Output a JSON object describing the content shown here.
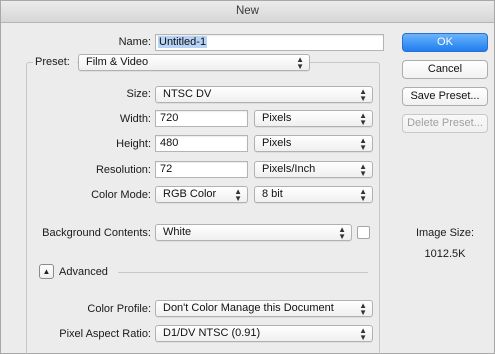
{
  "window": {
    "title": "New"
  },
  "form": {
    "name": {
      "label": "Name:",
      "value": "Untitled-1"
    },
    "preset": {
      "label": "Preset:",
      "value": "Film & Video"
    },
    "size": {
      "label": "Size:",
      "value": "NTSC DV"
    },
    "width": {
      "label": "Width:",
      "value": "720",
      "unit": "Pixels"
    },
    "height": {
      "label": "Height:",
      "value": "480",
      "unit": "Pixels"
    },
    "resolution": {
      "label": "Resolution:",
      "value": "72",
      "unit": "Pixels/Inch"
    },
    "color_mode": {
      "label": "Color Mode:",
      "value": "RGB Color",
      "depth": "8 bit"
    },
    "background": {
      "label": "Background Contents:",
      "value": "White",
      "swatch": "#ffffff"
    },
    "advanced": {
      "label": "Advanced",
      "expanded": true
    },
    "color_profile": {
      "label": "Color Profile:",
      "value": "Don't Color Manage this Document"
    },
    "pixel_aspect": {
      "label": "Pixel Aspect Ratio:",
      "value": "D1/DV NTSC (0.91)"
    }
  },
  "buttons": {
    "ok": "OK",
    "cancel": "Cancel",
    "save_preset": "Save Preset...",
    "delete_preset": "Delete Preset..."
  },
  "image_size": {
    "label": "Image Size:",
    "value": "1012.5K"
  },
  "icons": {
    "popup_arrows": "up-down-arrows-icon",
    "disclosure": "disclosure-triangle-icon"
  },
  "colors": {
    "default_button": "#1f7ef0",
    "selection": "#b7d3f5"
  }
}
